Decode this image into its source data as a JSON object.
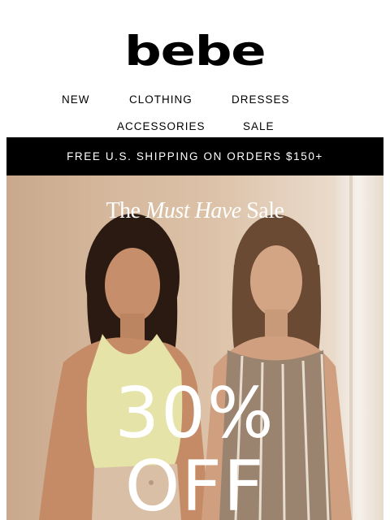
{
  "header": {
    "logo_text": "bebe"
  },
  "nav": {
    "row1": [
      "NEW",
      "CLOTHING",
      "DRESSES"
    ],
    "row2": [
      "ACCESSORIES",
      "SALE"
    ]
  },
  "banner": {
    "text": "FREE U.S. SHIPPING ON ORDERS $150+"
  },
  "hero": {
    "headline_pre": "The ",
    "headline_italic": "Must Have",
    "headline_post": " Sale",
    "discount": "30%",
    "discount_suffix": "OFF"
  },
  "colors": {
    "banner_bg": "#000000",
    "banner_text": "#ffffff",
    "hero_text": "#ffffff"
  }
}
